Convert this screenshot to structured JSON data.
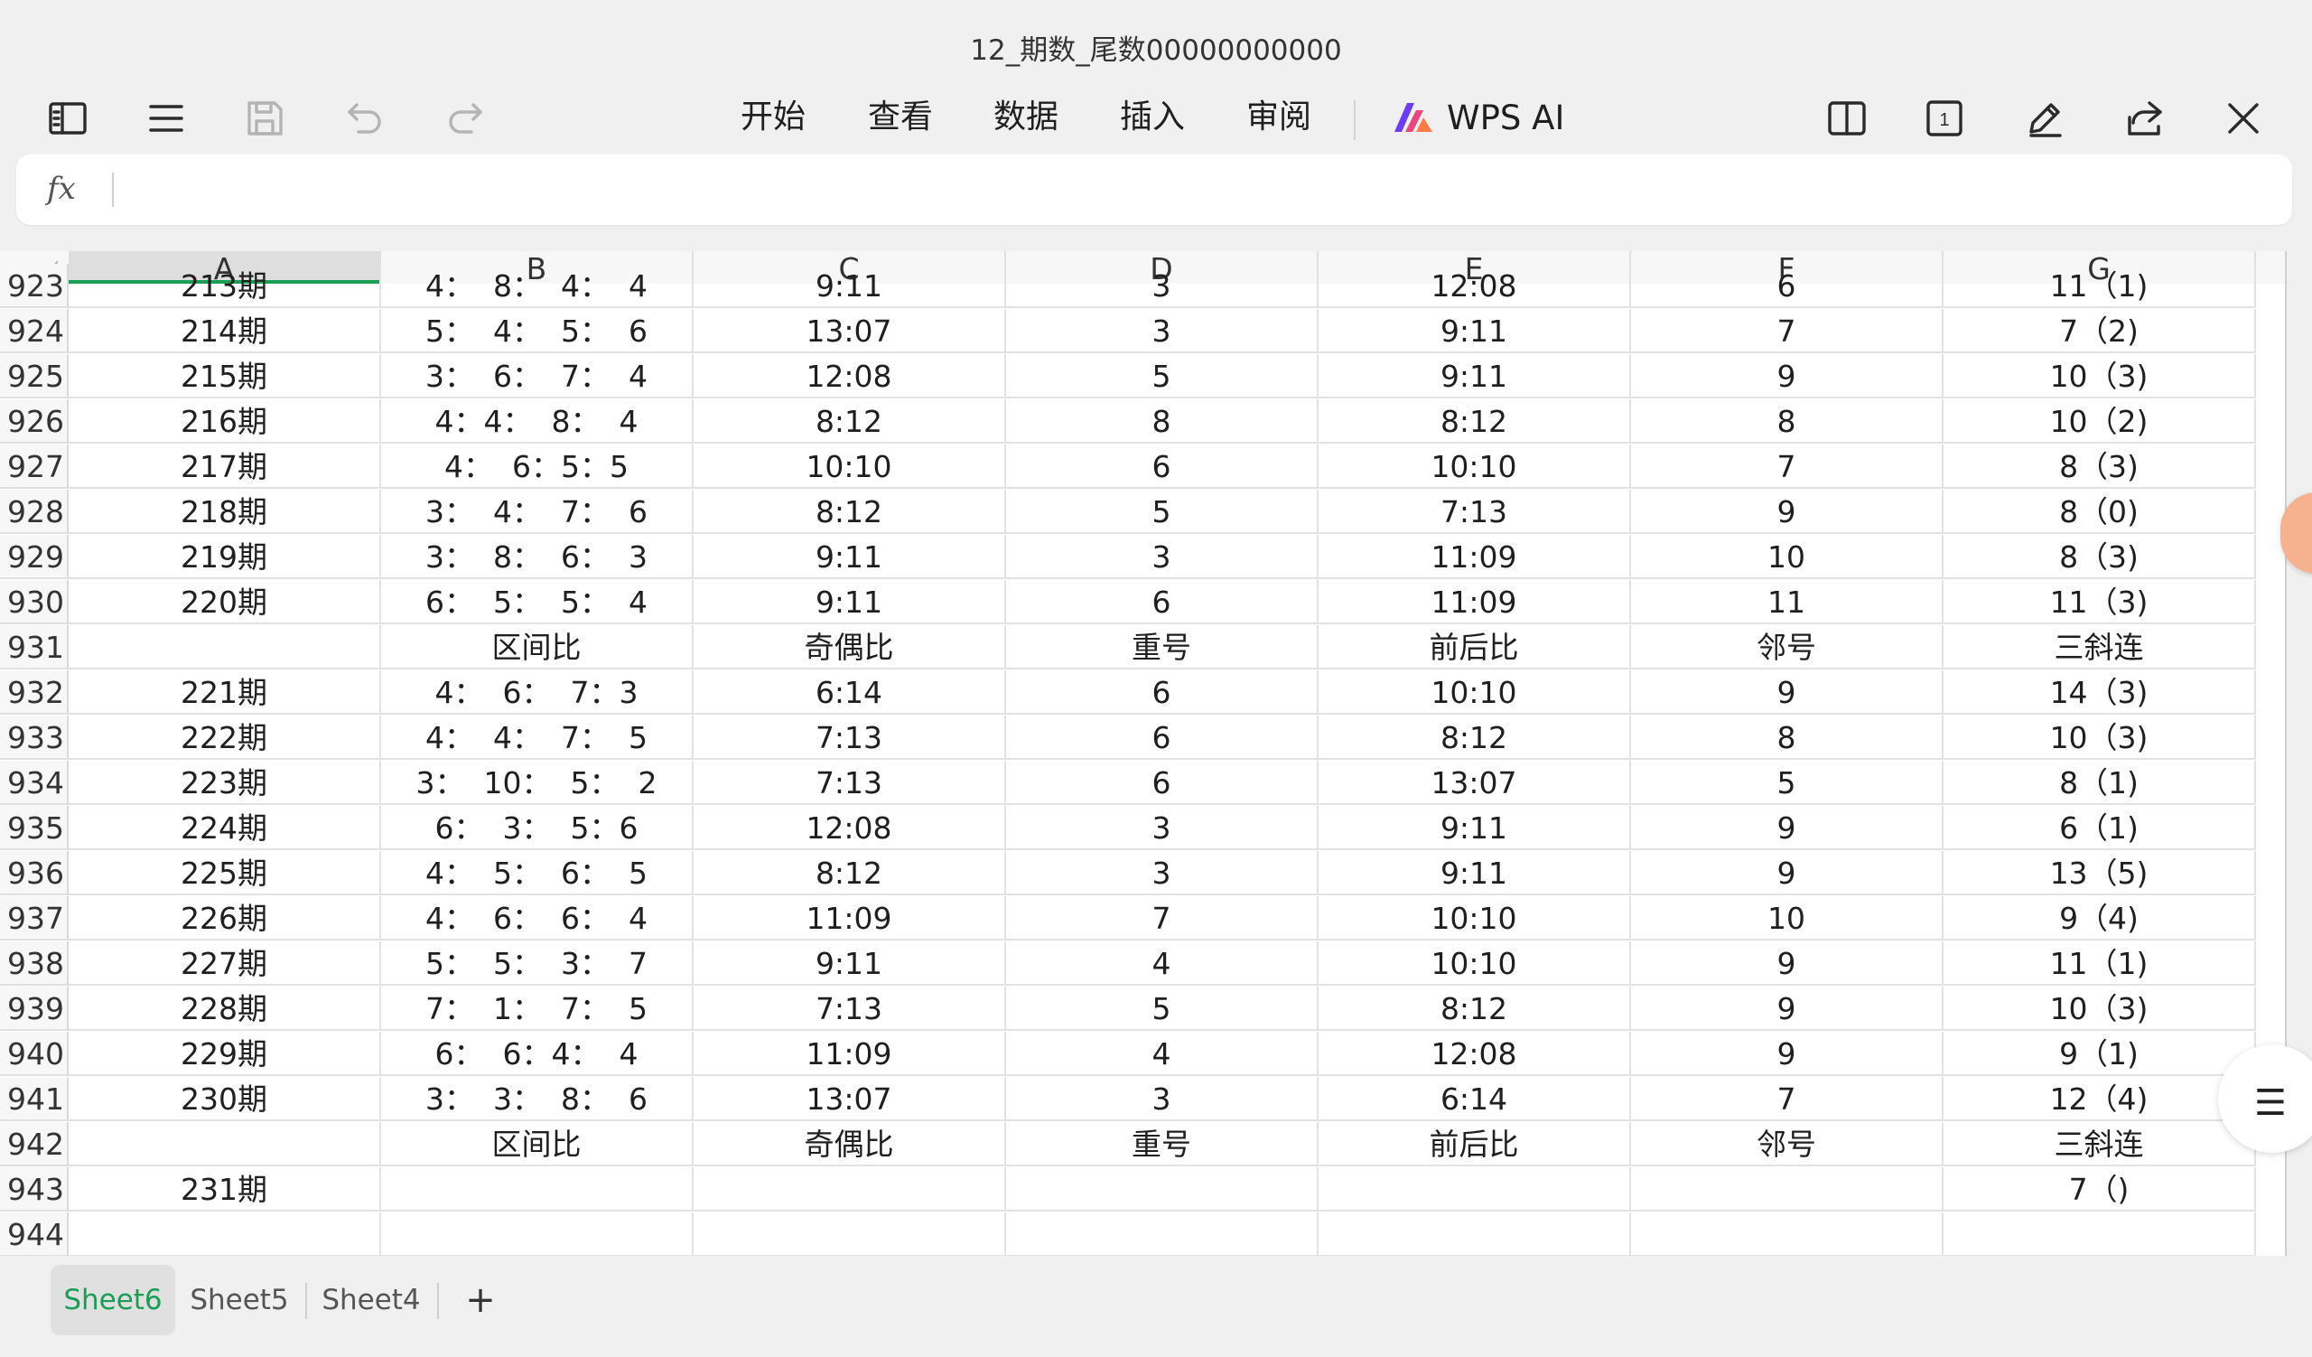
{
  "window": {
    "title": "12_期数_尾数00000000000"
  },
  "toolbar": {
    "left_icons": [
      "sidebar-toggle-icon",
      "hamburger-menu-icon",
      "save-icon",
      "undo-icon",
      "redo-icon"
    ],
    "menu": [
      "开始",
      "查看",
      "数据",
      "插入",
      "审阅"
    ],
    "ai_label": "WPS AI",
    "right_icons": [
      "split-view-icon",
      "page-number-icon",
      "pen-icon",
      "share-icon",
      "close-icon"
    ],
    "page_number_badge": "1"
  },
  "formula_bar": {
    "fx_label": "fx",
    "value": ""
  },
  "sheet": {
    "columns": [
      "A",
      "B",
      "C",
      "D",
      "E",
      "F",
      "G"
    ],
    "active_column": "A",
    "rows": [
      {
        "n": "923",
        "cells": [
          "213期",
          "4：  8：  4：  4",
          "9:11",
          "3",
          "12:08",
          "6",
          "11（1)"
        ]
      },
      {
        "n": "924",
        "cells": [
          "214期",
          "5：  4：  5：  6",
          "13:07",
          "3",
          "9:11",
          "7",
          "7（2)"
        ]
      },
      {
        "n": "925",
        "cells": [
          "215期",
          "3：  6：  7：  4",
          "12:08",
          "5",
          "9:11",
          "9",
          "10（3)"
        ]
      },
      {
        "n": "926",
        "cells": [
          "216期",
          "4：4：  8：  4",
          "8:12",
          "8",
          "8:12",
          "8",
          "10（2)"
        ]
      },
      {
        "n": "927",
        "cells": [
          "217期",
          "4：  6：5：5",
          "10:10",
          "6",
          "10:10",
          "7",
          "8（3)"
        ]
      },
      {
        "n": "928",
        "cells": [
          "218期",
          "3：  4：  7：  6",
          "8:12",
          "5",
          "7:13",
          "9",
          "8（0)"
        ]
      },
      {
        "n": "929",
        "cells": [
          "219期",
          "3：  8：  6：  3",
          "9:11",
          "3",
          "11:09",
          "10",
          "8（3)"
        ]
      },
      {
        "n": "930",
        "cells": [
          "220期",
          "6：  5：  5：  4",
          "9:11",
          "6",
          "11:09",
          "11",
          "11（3)"
        ]
      },
      {
        "n": "931",
        "cells": [
          "",
          "区间比",
          "奇偶比",
          "重号",
          "前后比",
          "邻号",
          "三斜连"
        ]
      },
      {
        "n": "932",
        "cells": [
          "221期",
          "4：  6：  7：3",
          "6:14",
          "6",
          "10:10",
          "9",
          "14（3)"
        ]
      },
      {
        "n": "933",
        "cells": [
          "222期",
          "4：  4：  7：  5",
          "7:13",
          "6",
          "8:12",
          "8",
          "10（3)"
        ]
      },
      {
        "n": "934",
        "cells": [
          "223期",
          "3：  10：  5：  2",
          "7:13",
          "6",
          "13:07",
          "5",
          "8（1)"
        ]
      },
      {
        "n": "935",
        "cells": [
          "224期",
          "6：  3：  5：6",
          "12:08",
          "3",
          "9:11",
          "9",
          "6（1)"
        ]
      },
      {
        "n": "936",
        "cells": [
          "225期",
          "4：  5：  6：  5",
          "8:12",
          "3",
          "9:11",
          "9",
          "13（5)"
        ]
      },
      {
        "n": "937",
        "cells": [
          "226期",
          "4：  6：  6：  4",
          "11:09",
          "7",
          "10:10",
          "10",
          "9（4)"
        ]
      },
      {
        "n": "938",
        "cells": [
          "227期",
          "5：  5：  3：  7",
          "9:11",
          "4",
          "10:10",
          "9",
          "11（1)"
        ]
      },
      {
        "n": "939",
        "cells": [
          "228期",
          "7：  1：  7：  5",
          "7:13",
          "5",
          "8:12",
          "9",
          "10（3)"
        ]
      },
      {
        "n": "940",
        "cells": [
          "229期",
          "6：  6：4：  4",
          "11:09",
          "4",
          "12:08",
          "9",
          "9（1)"
        ]
      },
      {
        "n": "941",
        "cells": [
          "230期",
          "3：  3：  8：  6",
          "13:07",
          "3",
          "6:14",
          "7",
          "12（4)"
        ]
      },
      {
        "n": "942",
        "cells": [
          "",
          "区间比",
          "奇偶比",
          "重号",
          "前后比",
          "邻号",
          "三斜连"
        ]
      },
      {
        "n": "943",
        "cells": [
          "231期",
          "",
          "",
          "",
          "",
          "",
          "7（)"
        ]
      },
      {
        "n": "944",
        "cells": [
          "",
          "",
          "",
          "",
          "",
          "",
          ""
        ]
      }
    ]
  },
  "sheet_tabs": [
    {
      "label": "Sheet6",
      "active": true
    },
    {
      "label": "Sheet5",
      "active": false
    },
    {
      "label": "Sheet4",
      "active": false
    }
  ],
  "add_sheet_label": "+",
  "colors": {
    "accent": "#1a9d54",
    "gridline": "#e2e2e2",
    "header_bg": "#f7f7f7"
  }
}
